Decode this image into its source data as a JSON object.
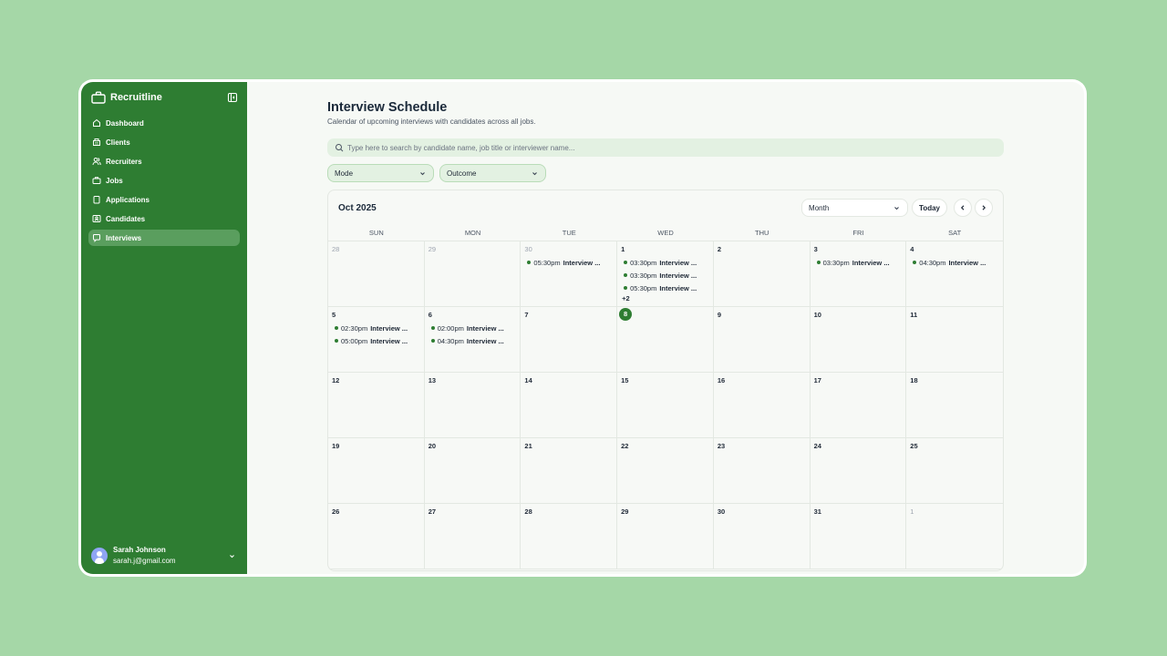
{
  "sidebar": {
    "brand": "Recruitline",
    "items": [
      {
        "label": "Dashboard",
        "icon": "home-icon"
      },
      {
        "label": "Clients",
        "icon": "building-icon"
      },
      {
        "label": "Recruiters",
        "icon": "users-icon"
      },
      {
        "label": "Jobs",
        "icon": "briefcase-icon"
      },
      {
        "label": "Applications",
        "icon": "clipboard-icon"
      },
      {
        "label": "Candidates",
        "icon": "id-card-icon"
      },
      {
        "label": "Interviews",
        "icon": "chat-icon",
        "active": true
      }
    ],
    "user": {
      "name": "Sarah Johnson",
      "email": "sarah.j@gmail.com"
    }
  },
  "page": {
    "title": "Interview Schedule",
    "subtitle": "Calendar of upcoming interviews with candidates across all jobs."
  },
  "search": {
    "placeholder": "Type here to search by candidate name, job title or interviewer name..."
  },
  "filters": {
    "mode": "Mode",
    "outcome": "Outcome"
  },
  "calendar": {
    "month_label": "Oct 2025",
    "view": "Month",
    "today_label": "Today",
    "weekdays": [
      "SUN",
      "MON",
      "TUE",
      "WED",
      "THU",
      "FRI",
      "SAT"
    ],
    "days": [
      {
        "n": "28",
        "outside": true,
        "events": []
      },
      {
        "n": "29",
        "outside": true,
        "events": []
      },
      {
        "n": "30",
        "outside": true,
        "events": [
          {
            "time": "05:30pm",
            "title": "Interview ..."
          }
        ]
      },
      {
        "n": "1",
        "events": [
          {
            "time": "03:30pm",
            "title": "Interview ..."
          },
          {
            "time": "03:30pm",
            "title": "Interview ..."
          },
          {
            "time": "05:30pm",
            "title": "Interview ..."
          }
        ],
        "more": "+2"
      },
      {
        "n": "2",
        "events": []
      },
      {
        "n": "3",
        "events": [
          {
            "time": "03:30pm",
            "title": "Interview ..."
          }
        ]
      },
      {
        "n": "4",
        "events": [
          {
            "time": "04:30pm",
            "title": "Interview ..."
          }
        ]
      },
      {
        "n": "5",
        "events": [
          {
            "time": "02:30pm",
            "title": "Interview ..."
          },
          {
            "time": "05:00pm",
            "title": "Interview ..."
          }
        ]
      },
      {
        "n": "6",
        "events": [
          {
            "time": "02:00pm",
            "title": "Interview ..."
          },
          {
            "time": "04:30pm",
            "title": "Interview ..."
          }
        ]
      },
      {
        "n": "7",
        "events": []
      },
      {
        "n": "8",
        "today": true,
        "events": []
      },
      {
        "n": "9",
        "events": []
      },
      {
        "n": "10",
        "events": []
      },
      {
        "n": "11",
        "events": []
      },
      {
        "n": "12",
        "events": []
      },
      {
        "n": "13",
        "events": []
      },
      {
        "n": "14",
        "events": []
      },
      {
        "n": "15",
        "events": []
      },
      {
        "n": "16",
        "events": []
      },
      {
        "n": "17",
        "events": []
      },
      {
        "n": "18",
        "events": []
      },
      {
        "n": "19",
        "events": []
      },
      {
        "n": "20",
        "events": []
      },
      {
        "n": "21",
        "events": []
      },
      {
        "n": "22",
        "events": []
      },
      {
        "n": "23",
        "events": []
      },
      {
        "n": "24",
        "events": []
      },
      {
        "n": "25",
        "events": []
      },
      {
        "n": "26",
        "events": []
      },
      {
        "n": "27",
        "events": []
      },
      {
        "n": "28",
        "events": []
      },
      {
        "n": "29",
        "events": []
      },
      {
        "n": "30",
        "events": []
      },
      {
        "n": "31",
        "events": []
      },
      {
        "n": "1",
        "outside": true,
        "events": []
      }
    ]
  },
  "colors": {
    "primary": "#2e7d32",
    "background": "#a5d7a7",
    "active_nav": "#5a9e5e"
  }
}
